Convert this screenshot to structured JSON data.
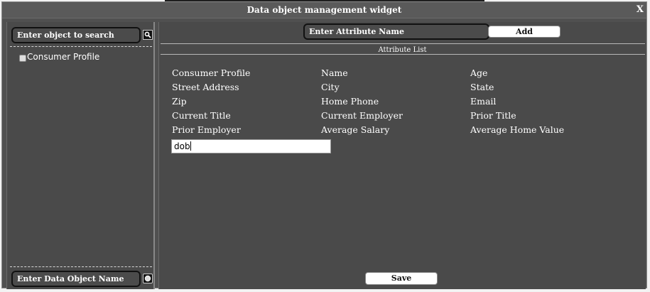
{
  "window": {
    "title": "Data object management widget",
    "close_label": "X"
  },
  "left": {
    "search_placeholder": "Enter object to search",
    "tree_items": [
      "Consumer Profile"
    ],
    "data_object_placeholder": "Enter Data Object Name"
  },
  "right": {
    "attr_name_placeholder": "Enter Attribute Name",
    "add_label": "Add",
    "list_header": "Attribute List",
    "attributes": [
      "Consumer Profile",
      "Name",
      "Age",
      "Street Address",
      "City",
      "State",
      "Zip",
      "Home Phone",
      "Email",
      "Current Title",
      "Current Employer",
      "Prior Title",
      "Prior Employer",
      "Average Salary",
      "Average Home Value"
    ],
    "new_attribute_value": "dob",
    "save_label": "Save"
  },
  "icons": {
    "search": "search-icon",
    "add_object": "circle-icon",
    "close": "close-icon"
  },
  "colors": {
    "panel_bg": "#4a4a4a",
    "widget_bg": "#505050",
    "text": "#ffffff"
  }
}
